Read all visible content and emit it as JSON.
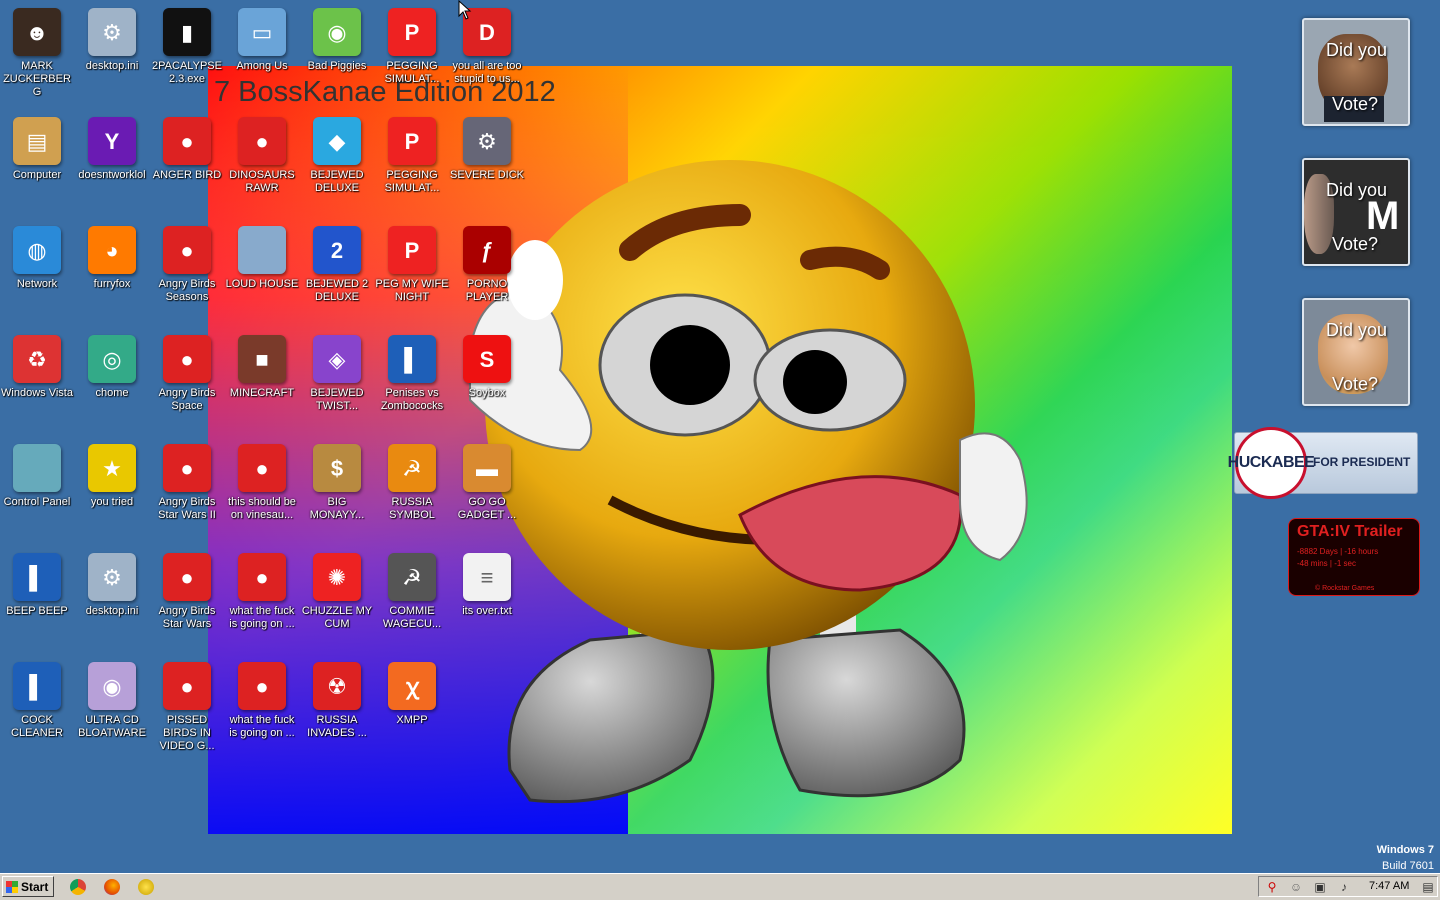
{
  "wallpaper": {
    "title": "7 BossKanae Edition 2012"
  },
  "desktop_icons": [
    {
      "label": "MARK ZUCKERBERG",
      "icon": "person-icon"
    },
    {
      "label": "desktop.ini",
      "icon": "settings-file-icon"
    },
    {
      "label": "2PACALYPSE 2.3.exe",
      "icon": "console-icon"
    },
    {
      "label": "Among Us",
      "icon": "scanner-icon"
    },
    {
      "label": "Bad Piggies",
      "icon": "bad-piggies-icon"
    },
    {
      "label": "PEGGING SIMULAT...",
      "icon": "p-logo-icon"
    },
    {
      "label": "you all are too stupid to us...",
      "icon": "dev-cpp-icon"
    },
    {
      "label": "Computer",
      "icon": "computer-icon"
    },
    {
      "label": "doesntworklol",
      "icon": "yahoo-messenger-icon"
    },
    {
      "label": "ANGER BIRD",
      "icon": "angry-bird-icon"
    },
    {
      "label": "DINOSAURS RAWR",
      "icon": "angry-bird-icon"
    },
    {
      "label": "BEJEWED DELUXE",
      "icon": "diamond-icon"
    },
    {
      "label": "PEGGING SIMULAT...",
      "icon": "p-logo-icon"
    },
    {
      "label": "SEVERE DICK",
      "icon": "sd-gear-icon"
    },
    {
      "label": "Network",
      "icon": "network-icon"
    },
    {
      "label": "furryfox",
      "icon": "firefox-icon"
    },
    {
      "label": "Angry Birds Seasons",
      "icon": "angry-bird-icon"
    },
    {
      "label": "LOUD HOUSE",
      "icon": "pig-icon"
    },
    {
      "label": "BEJEWED 2 DELUXE",
      "icon": "bejeweled-2-icon"
    },
    {
      "label": "PEG MY WIFE NIGHT",
      "icon": "p-logo-icon"
    },
    {
      "label": "PORNO PLAYER",
      "icon": "flash-icon"
    },
    {
      "label": "Windows Vista",
      "icon": "recycle-bin-icon"
    },
    {
      "label": "chome",
      "icon": "chrome-icon"
    },
    {
      "label": "Angry Birds Space",
      "icon": "angry-bird-icon"
    },
    {
      "label": "MINECRAFT",
      "icon": "minecraft-icon"
    },
    {
      "label": "BEJEWED TWIST...",
      "icon": "bejeweled-twist-icon"
    },
    {
      "label": "Penises vs Zombococks",
      "icon": "blue-book-icon"
    },
    {
      "label": "Soybox",
      "icon": "soybox-icon"
    },
    {
      "label": "Control Panel",
      "icon": "control-panel-icon"
    },
    {
      "label": "you tried",
      "icon": "star-icon"
    },
    {
      "label": "Angry Birds Star Wars II",
      "icon": "angry-bird-icon"
    },
    {
      "label": "this should be on vinesau...",
      "icon": "angry-bird-icon"
    },
    {
      "label": "BIG MONAYY...",
      "icon": "money-bag-icon"
    },
    {
      "label": "RUSSIA SYMBOL",
      "icon": "russia-symbol-icon"
    },
    {
      "label": "GO GO GADGET ...",
      "icon": "briefcase-icon"
    },
    {
      "label": "BEEP BEEP",
      "icon": "blue-book-icon"
    },
    {
      "label": "desktop.ini",
      "icon": "settings-file-icon"
    },
    {
      "label": "Angry Birds Star Wars",
      "icon": "angry-bird-icon"
    },
    {
      "label": "what the fuck is going on ...",
      "icon": "angry-bird-icon"
    },
    {
      "label": "CHUZZLE MY CUM",
      "icon": "chuzzle-icon"
    },
    {
      "label": "COMMIE WAGECU...",
      "icon": "commie-icon"
    },
    {
      "label": "its over.txt",
      "icon": "text-file-icon"
    },
    {
      "label": "COCK CLEANER",
      "icon": "blue-book-icon"
    },
    {
      "label": "ULTRA CD BLOATWARE",
      "icon": "cd-icon"
    },
    {
      "label": "PISSED BIRDS IN VIDEO G...",
      "icon": "angry-bird-icon"
    },
    {
      "label": "what the fuck is going on ...",
      "icon": "angry-bird-icon"
    },
    {
      "label": "RUSSIA INVADES ...",
      "icon": "radiation-icon"
    },
    {
      "label": "XMPP",
      "icon": "xampp-icon"
    }
  ],
  "gadgets": {
    "vote": [
      {
        "line1": "Did you",
        "line2": "Vote?"
      },
      {
        "line1": "Did you",
        "line2": "Vote?"
      },
      {
        "line1": "Did you",
        "line2": "Vote?"
      }
    ],
    "huckabee": {
      "name": "HUCKABEE",
      "sub": "FOR PRESIDENT"
    },
    "gta": {
      "title": "GTA:IV  Trailer",
      "count1": "-8882 Days | -16 hours",
      "count2": "-48 mins | -1 sec",
      "footer": "© Rockstar Games"
    }
  },
  "watermark": {
    "os": "Windows 7",
    "build": "Build 7601"
  },
  "taskbar": {
    "start_label": "Start",
    "clock": "7:47 AM"
  },
  "colors": {
    "desktop_bg": "#3a6ea5",
    "taskbar": "#d4d0c8"
  }
}
